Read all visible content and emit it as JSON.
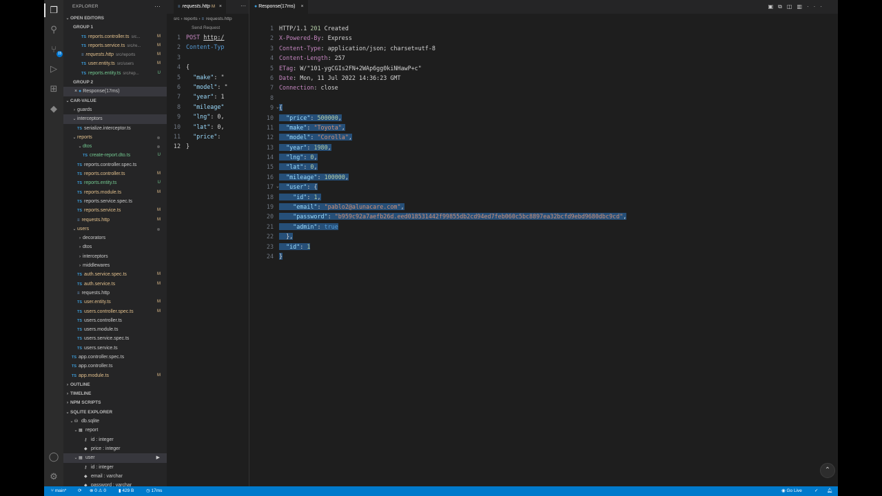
{
  "activity": {
    "items": [
      "files-icon",
      "search-icon",
      "source-control-icon",
      "run-debug-icon",
      "extensions-icon",
      "docker-icon"
    ],
    "badge": "15"
  },
  "sidebar": {
    "title": "EXPLORER",
    "open_editors": {
      "label": "OPEN EDITORS",
      "group1": "GROUP 1",
      "group1_items": [
        {
          "icon": "TS",
          "name": "reports.controller.ts",
          "path": "src...",
          "flag": "M"
        },
        {
          "icon": "TS",
          "name": "reports.service.ts",
          "path": "src/re...",
          "flag": "M"
        },
        {
          "icon": "#",
          "name": "requests.http",
          "path": "src/reports",
          "flag": "M"
        },
        {
          "icon": "TS",
          "name": "user.entity.ts",
          "path": "src/users",
          "flag": "M"
        },
        {
          "icon": "TS",
          "name": "reports.entity.ts",
          "path": "src/rep...",
          "flag": "U"
        }
      ],
      "group2": "GROUP 2",
      "group2_items": [
        {
          "name": "Response(17ms)"
        }
      ]
    },
    "project": {
      "label": "CAR-VALUE",
      "tree": [
        {
          "depth": 1,
          "kind": "folder",
          "name": "guards",
          "open": false
        },
        {
          "depth": 1,
          "kind": "folder",
          "name": "interceptors",
          "open": true,
          "selected": true
        },
        {
          "depth": 2,
          "kind": "file",
          "icon": "TS",
          "name": "serialize.interceptor.ts"
        },
        {
          "depth": 1,
          "kind": "folder",
          "name": "reports",
          "open": true,
          "color": "m",
          "dot": true
        },
        {
          "depth": 2,
          "kind": "folder",
          "name": "dtos",
          "open": true,
          "color": "u",
          "dot": true
        },
        {
          "depth": 3,
          "kind": "file",
          "icon": "TS",
          "name": "create-report.dto.ts",
          "color": "u",
          "flag": "U"
        },
        {
          "depth": 2,
          "kind": "file",
          "icon": "TS",
          "name": "reports.controller.spec.ts"
        },
        {
          "depth": 2,
          "kind": "file",
          "icon": "TS",
          "name": "reports.controller.ts",
          "color": "m",
          "flag": "M"
        },
        {
          "depth": 2,
          "kind": "file",
          "icon": "TS",
          "name": "reports.entity.ts",
          "color": "u",
          "flag": "U"
        },
        {
          "depth": 2,
          "kind": "file",
          "icon": "TS",
          "name": "reports.module.ts",
          "color": "m",
          "flag": "M"
        },
        {
          "depth": 2,
          "kind": "file",
          "icon": "TS",
          "name": "reports.service.spec.ts"
        },
        {
          "depth": 2,
          "kind": "file",
          "icon": "TS",
          "name": "reports.service.ts",
          "color": "m",
          "flag": "M"
        },
        {
          "depth": 2,
          "kind": "file",
          "icon": "#",
          "name": "requests.http",
          "color": "m",
          "flag": "M"
        },
        {
          "depth": 1,
          "kind": "folder",
          "name": "users",
          "open": true,
          "color": "m",
          "dot": true
        },
        {
          "depth": 2,
          "kind": "folder",
          "name": "decorators",
          "open": false
        },
        {
          "depth": 2,
          "kind": "folder",
          "name": "dtos",
          "open": false
        },
        {
          "depth": 2,
          "kind": "folder",
          "name": "interceptors",
          "open": false
        },
        {
          "depth": 2,
          "kind": "folder",
          "name": "middlewares",
          "open": false
        },
        {
          "depth": 2,
          "kind": "file",
          "icon": "TS",
          "name": "auth.service.spec.ts",
          "color": "m",
          "flag": "M"
        },
        {
          "depth": 2,
          "kind": "file",
          "icon": "TS",
          "name": "auth.service.ts",
          "color": "m",
          "flag": "M"
        },
        {
          "depth": 2,
          "kind": "file",
          "icon": "#",
          "name": "requests.http"
        },
        {
          "depth": 2,
          "kind": "file",
          "icon": "TS",
          "name": "user.entity.ts",
          "color": "m",
          "flag": "M"
        },
        {
          "depth": 2,
          "kind": "file",
          "icon": "TS",
          "name": "users.controller.spec.ts",
          "color": "m",
          "flag": "M"
        },
        {
          "depth": 2,
          "kind": "file",
          "icon": "TS",
          "name": "users.controller.ts"
        },
        {
          "depth": 2,
          "kind": "file",
          "icon": "TS",
          "name": "users.module.ts"
        },
        {
          "depth": 2,
          "kind": "file",
          "icon": "TS",
          "name": "users.service.spec.ts"
        },
        {
          "depth": 2,
          "kind": "file",
          "icon": "TS",
          "name": "users.service.ts"
        },
        {
          "depth": 1,
          "kind": "file",
          "icon": "TS",
          "name": "app.controller.spec.ts"
        },
        {
          "depth": 1,
          "kind": "file",
          "icon": "TS",
          "name": "app.controller.ts"
        },
        {
          "depth": 1,
          "kind": "file",
          "icon": "TS",
          "name": "app.module.ts",
          "color": "m",
          "flag": "M"
        }
      ]
    },
    "outline": "OUTLINE",
    "timeline": "TIMELINE",
    "npm_scripts": "NPM SCRIPTS",
    "sqlite": {
      "label": "SQLITE EXPLORER",
      "db": "db.sqlite",
      "tables": [
        {
          "name": "report",
          "columns": [
            {
              "icon": "key",
              "text": "id : integer"
            },
            {
              "icon": "diamond",
              "text": "price : integer"
            }
          ]
        },
        {
          "name": "user",
          "selected": true,
          "columns": [
            {
              "icon": "key",
              "text": "id : integer"
            },
            {
              "icon": "diamond",
              "text": "email : varchar"
            },
            {
              "icon": "diamond",
              "text": "password : varchar"
            }
          ]
        }
      ]
    }
  },
  "editor1": {
    "tab": {
      "name": "requests.http",
      "flag": "M"
    },
    "breadcrumb": [
      "src",
      "reports",
      "requests.http"
    ],
    "codelens": "Send Request",
    "lines": [
      {
        "n": "1",
        "parts": [
          [
            "kw",
            "POST "
          ],
          [
            "url",
            "http:/"
          ]
        ]
      },
      {
        "n": "2",
        "parts": [
          [
            "hkey",
            "Content-Typ"
          ]
        ]
      },
      {
        "n": "3",
        "parts": []
      },
      {
        "n": "4",
        "parts": [
          [
            "hval",
            "{"
          ]
        ]
      },
      {
        "n": "5",
        "parts": [
          [
            "hval",
            "  "
          ],
          [
            "jkey",
            "\"make\""
          ],
          [
            "hval",
            ": \""
          ]
        ]
      },
      {
        "n": "6",
        "parts": [
          [
            "hval",
            "  "
          ],
          [
            "jkey",
            "\"model\""
          ],
          [
            "hval",
            ": \""
          ]
        ]
      },
      {
        "n": "7",
        "parts": [
          [
            "hval",
            "  "
          ],
          [
            "jkey",
            "\"year\""
          ],
          [
            "hval",
            ": 1"
          ]
        ]
      },
      {
        "n": "8",
        "parts": [
          [
            "hval",
            "  "
          ],
          [
            "jkey",
            "\"mileage\""
          ]
        ]
      },
      {
        "n": "9",
        "parts": [
          [
            "hval",
            "  "
          ],
          [
            "jkey",
            "\"lng\""
          ],
          [
            "hval",
            ": 0,"
          ]
        ]
      },
      {
        "n": "10",
        "parts": [
          [
            "hval",
            "  "
          ],
          [
            "jkey",
            "\"lat\""
          ],
          [
            "hval",
            ": 0,"
          ]
        ]
      },
      {
        "n": "11",
        "parts": [
          [
            "hval",
            "  "
          ],
          [
            "jkey",
            "\"price\""
          ],
          [
            "hval",
            ": "
          ]
        ]
      },
      {
        "n": "12",
        "parts": [
          [
            "hval",
            "}"
          ]
        ],
        "current": true
      }
    ]
  },
  "editor2": {
    "tab": "Response(17ms)",
    "lines": [
      {
        "n": "1",
        "parts": [
          [
            "hval",
            "HTTP/1.1 "
          ],
          [
            "num",
            "201"
          ],
          [
            "hval",
            " Created"
          ]
        ]
      },
      {
        "n": "2",
        "parts": [
          [
            "kw",
            "X-Powered-By"
          ],
          [
            "hval",
            ": Express"
          ]
        ]
      },
      {
        "n": "3",
        "parts": [
          [
            "kw",
            "Content-Type"
          ],
          [
            "hval",
            ": application/json; charset=utf-8"
          ]
        ]
      },
      {
        "n": "4",
        "parts": [
          [
            "kw",
            "Content-Length"
          ],
          [
            "hval",
            ": 257"
          ]
        ]
      },
      {
        "n": "5",
        "parts": [
          [
            "kw",
            "ETag"
          ],
          [
            "hval",
            ": W/\"101-ygCGIs2FN+2WAp6gg0kiNHawP+c\""
          ]
        ]
      },
      {
        "n": "6",
        "parts": [
          [
            "kw",
            "Date"
          ],
          [
            "hval",
            ": Mon, 11 Jul 2022 14:36:23 GMT"
          ]
        ]
      },
      {
        "n": "7",
        "parts": [
          [
            "kw",
            "Connection"
          ],
          [
            "hval",
            ": close"
          ]
        ]
      },
      {
        "n": "8",
        "parts": []
      },
      {
        "n": "9",
        "fold": true,
        "sel": true,
        "parts": [
          [
            "hval",
            "{"
          ]
        ]
      },
      {
        "n": "10",
        "sel": true,
        "parts": [
          [
            "hval",
            "  "
          ],
          [
            "jkey",
            "\"price\""
          ],
          [
            "hval",
            ": "
          ],
          [
            "jnum",
            "500000"
          ],
          [
            "hval",
            ","
          ]
        ]
      },
      {
        "n": "11",
        "sel": true,
        "parts": [
          [
            "hval",
            "  "
          ],
          [
            "jkey",
            "\"make\""
          ],
          [
            "hval",
            ": "
          ],
          [
            "jstr",
            "\"Toyota\""
          ],
          [
            "hval",
            ","
          ]
        ]
      },
      {
        "n": "12",
        "sel": true,
        "parts": [
          [
            "hval",
            "  "
          ],
          [
            "jkey",
            "\"model\""
          ],
          [
            "hval",
            ": "
          ],
          [
            "jstr",
            "\"Corolla\""
          ],
          [
            "hval",
            ","
          ]
        ]
      },
      {
        "n": "13",
        "sel": true,
        "parts": [
          [
            "hval",
            "  "
          ],
          [
            "jkey",
            "\"year\""
          ],
          [
            "hval",
            ": "
          ],
          [
            "jnum",
            "1980"
          ],
          [
            "hval",
            ","
          ]
        ]
      },
      {
        "n": "14",
        "sel": true,
        "parts": [
          [
            "hval",
            "  "
          ],
          [
            "jkey",
            "\"lng\""
          ],
          [
            "hval",
            ": "
          ],
          [
            "jnum",
            "0"
          ],
          [
            "hval",
            ","
          ]
        ]
      },
      {
        "n": "15",
        "sel": true,
        "parts": [
          [
            "hval",
            "  "
          ],
          [
            "jkey",
            "\"lat\""
          ],
          [
            "hval",
            ": "
          ],
          [
            "jnum",
            "0"
          ],
          [
            "hval",
            ","
          ]
        ]
      },
      {
        "n": "16",
        "sel": true,
        "parts": [
          [
            "hval",
            "  "
          ],
          [
            "jkey",
            "\"mileage\""
          ],
          [
            "hval",
            ": "
          ],
          [
            "jnum",
            "100000"
          ],
          [
            "hval",
            ","
          ]
        ]
      },
      {
        "n": "17",
        "fold": true,
        "sel": true,
        "parts": [
          [
            "hval",
            "  "
          ],
          [
            "jkey",
            "\"user\""
          ],
          [
            "hval",
            ": {"
          ]
        ]
      },
      {
        "n": "18",
        "sel": true,
        "parts": [
          [
            "hval",
            "    "
          ],
          [
            "jkey",
            "\"id\""
          ],
          [
            "hval",
            ": "
          ],
          [
            "jnum",
            "1"
          ],
          [
            "hval",
            ","
          ]
        ]
      },
      {
        "n": "19",
        "sel": true,
        "parts": [
          [
            "hval",
            "    "
          ],
          [
            "jkey",
            "\"email\""
          ],
          [
            "hval",
            ": "
          ],
          [
            "jstr",
            "\"pablo2@alunacare.com\""
          ],
          [
            "hval",
            ","
          ]
        ]
      },
      {
        "n": "20",
        "sel": true,
        "parts": [
          [
            "hval",
            "    "
          ],
          [
            "jkey",
            "\"password\""
          ],
          [
            "hval",
            ": "
          ],
          [
            "jstr",
            "\"b959c92a7aefb26d.eed018531442f99855db2cd94ed7feb060c5bc8897ea32bcfd9ebd9680dbc9cd\""
          ],
          [
            "hval",
            ","
          ]
        ]
      },
      {
        "n": "21",
        "sel": true,
        "parts": [
          [
            "hval",
            "    "
          ],
          [
            "jkey",
            "\"admin\""
          ],
          [
            "hval",
            ": "
          ],
          [
            "jbool",
            "true"
          ]
        ]
      },
      {
        "n": "22",
        "sel": true,
        "parts": [
          [
            "hval",
            "  },"
          ]
        ]
      },
      {
        "n": "23",
        "sel": true,
        "parts": [
          [
            "hval",
            "  "
          ],
          [
            "jkey",
            "\"id\""
          ],
          [
            "hval",
            ": "
          ],
          [
            "jnum",
            "1"
          ]
        ]
      },
      {
        "n": "24",
        "sel": true,
        "parts": [
          [
            "hval",
            "}"
          ]
        ]
      }
    ]
  },
  "status": {
    "branch": "main*",
    "errors": "0",
    "warnings": "0",
    "size": "429 B",
    "time": "17ms",
    "go_live": "Go Live"
  }
}
